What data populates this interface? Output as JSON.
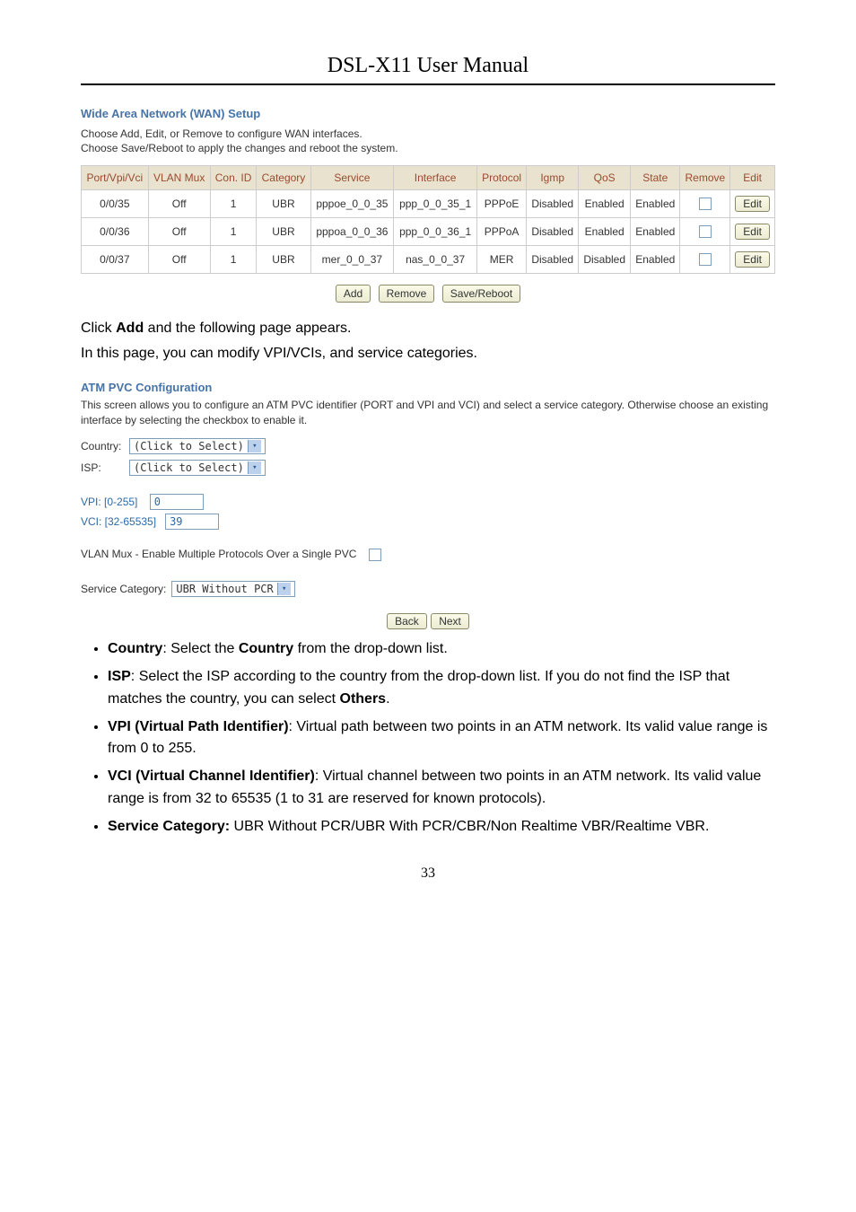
{
  "doc_title": "DSL-X11 User Manual",
  "wan_setup": {
    "title": "Wide Area Network (WAN) Setup",
    "line1": "Choose Add, Edit, or Remove to configure WAN interfaces.",
    "line2": "Choose Save/Reboot to apply the changes and reboot the system.",
    "headers": {
      "port": "Port/Vpi/Vci",
      "vlan": "VLAN Mux",
      "con": "Con. ID",
      "cat": "Category",
      "svc": "Service",
      "iface": "Interface",
      "proto": "Protocol",
      "igmp": "Igmp",
      "qos": "QoS",
      "state": "State",
      "remove": "Remove",
      "edit": "Edit"
    },
    "rows": [
      {
        "port": "0/0/35",
        "vlan": "Off",
        "con": "1",
        "cat": "UBR",
        "svc": "pppoe_0_0_35",
        "iface": "ppp_0_0_35_1",
        "proto": "PPPoE",
        "igmp": "Disabled",
        "qos": "Enabled",
        "state": "Enabled",
        "edit": "Edit"
      },
      {
        "port": "0/0/36",
        "vlan": "Off",
        "con": "1",
        "cat": "UBR",
        "svc": "pppoa_0_0_36",
        "iface": "ppp_0_0_36_1",
        "proto": "PPPoA",
        "igmp": "Disabled",
        "qos": "Enabled",
        "state": "Enabled",
        "edit": "Edit"
      },
      {
        "port": "0/0/37",
        "vlan": "Off",
        "con": "1",
        "cat": "UBR",
        "svc": "mer_0_0_37",
        "iface": "nas_0_0_37",
        "proto": "MER",
        "igmp": "Disabled",
        "qos": "Disabled",
        "state": "Enabled",
        "edit": "Edit"
      }
    ],
    "buttons": {
      "add": "Add",
      "remove": "Remove",
      "save": "Save/Reboot"
    }
  },
  "para1_a": "Click ",
  "para1_b": "Add",
  "para1_c": " and the following page appears.",
  "para2": "In this page, you can modify VPI/VCIs, and service categories.",
  "atm": {
    "title": "ATM PVC Configuration",
    "desc": "This screen allows you to configure an ATM PVC identifier (PORT and VPI and VCI) and select a service category. Otherwise choose an existing interface by selecting the checkbox to enable it.",
    "country_label": "Country:",
    "country_value": "(Click to Select)",
    "isp_label": "ISP:",
    "isp_value": "(Click to Select)",
    "vpi_label": "VPI: [0-255]",
    "vpi_value": "0",
    "vci_label": "VCI: [32-65535]",
    "vci_value": "39",
    "vlan_label": "VLAN Mux - Enable Multiple Protocols Over a Single PVC",
    "svc_cat_label": "Service Category:",
    "svc_cat_value": "UBR Without PCR",
    "back": "Back",
    "next": "Next"
  },
  "bullets": [
    {
      "t": "Country",
      "d": ": Select the ",
      "b": "Country",
      "d2": " from the drop-down list."
    },
    {
      "t": "ISP",
      "d": ": Select the ISP according to the country from the drop-down list. If you do not find the ISP that matches the country, you can select ",
      "b": "Others",
      "d2": "."
    },
    {
      "t": "VPI (Virtual Path Identifier)",
      "d": ": Virtual path between two points in an ATM network. Its valid value range is from 0 to 255.",
      "b": "",
      "d2": ""
    },
    {
      "t": "VCI (Virtual Channel Identifier)",
      "d": ": Virtual channel between two points in an ATM network. Its valid value range is from 32 to 65535 (1 to 31 are reserved for known protocols).",
      "b": "",
      "d2": ""
    },
    {
      "t": "Service Category:",
      "d": " UBR Without PCR/UBR With PCR/CBR/Non Realtime VBR/Realtime VBR.",
      "b": "",
      "d2": ""
    }
  ],
  "page_number": "33"
}
